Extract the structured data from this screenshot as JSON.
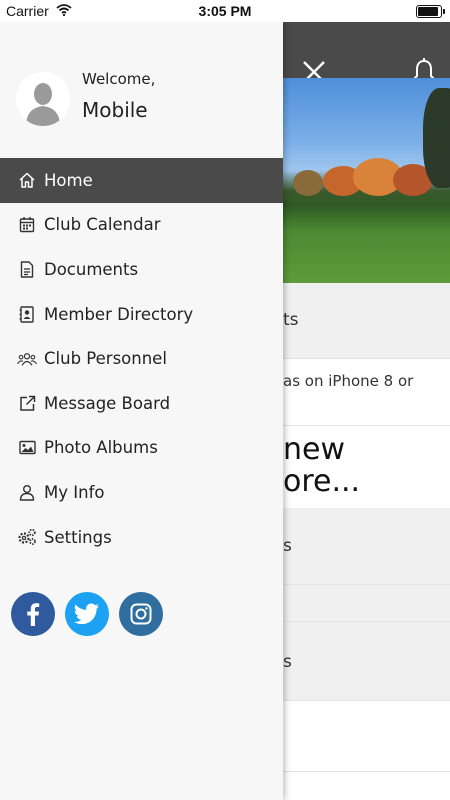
{
  "status_bar": {
    "carrier": "Carrier",
    "time": "3:05 PM"
  },
  "profile": {
    "welcome": "Welcome,",
    "name": "Mobile"
  },
  "menu": [
    {
      "label": "Home",
      "icon": "home-icon",
      "active": true
    },
    {
      "label": "Club Calendar",
      "icon": "calendar-icon"
    },
    {
      "label": "Documents",
      "icon": "document-icon"
    },
    {
      "label": "Member Directory",
      "icon": "contacts-icon"
    },
    {
      "label": "Club Personnel",
      "icon": "people-icon"
    },
    {
      "label": "Message Board",
      "icon": "external-link-icon"
    },
    {
      "label": "Photo Albums",
      "icon": "image-icon"
    },
    {
      "label": "My Info",
      "icon": "user-icon"
    },
    {
      "label": "Settings",
      "icon": "gear-icon"
    }
  ],
  "social": [
    "facebook-icon",
    "twitter-icon",
    "instagram-icon"
  ],
  "background": {
    "row1": "ts",
    "row2": "as on iPhone 8 or",
    "row3a": "new",
    "row3b": "ore...",
    "row4": "s",
    "row5": "s"
  },
  "colors": {
    "drawer_active": "#4a4a4a",
    "drawer_bg": "#f7f7f7",
    "facebook": "#2f5a9e",
    "twitter": "#1da1f2",
    "instagram": "#2f6e9e"
  }
}
